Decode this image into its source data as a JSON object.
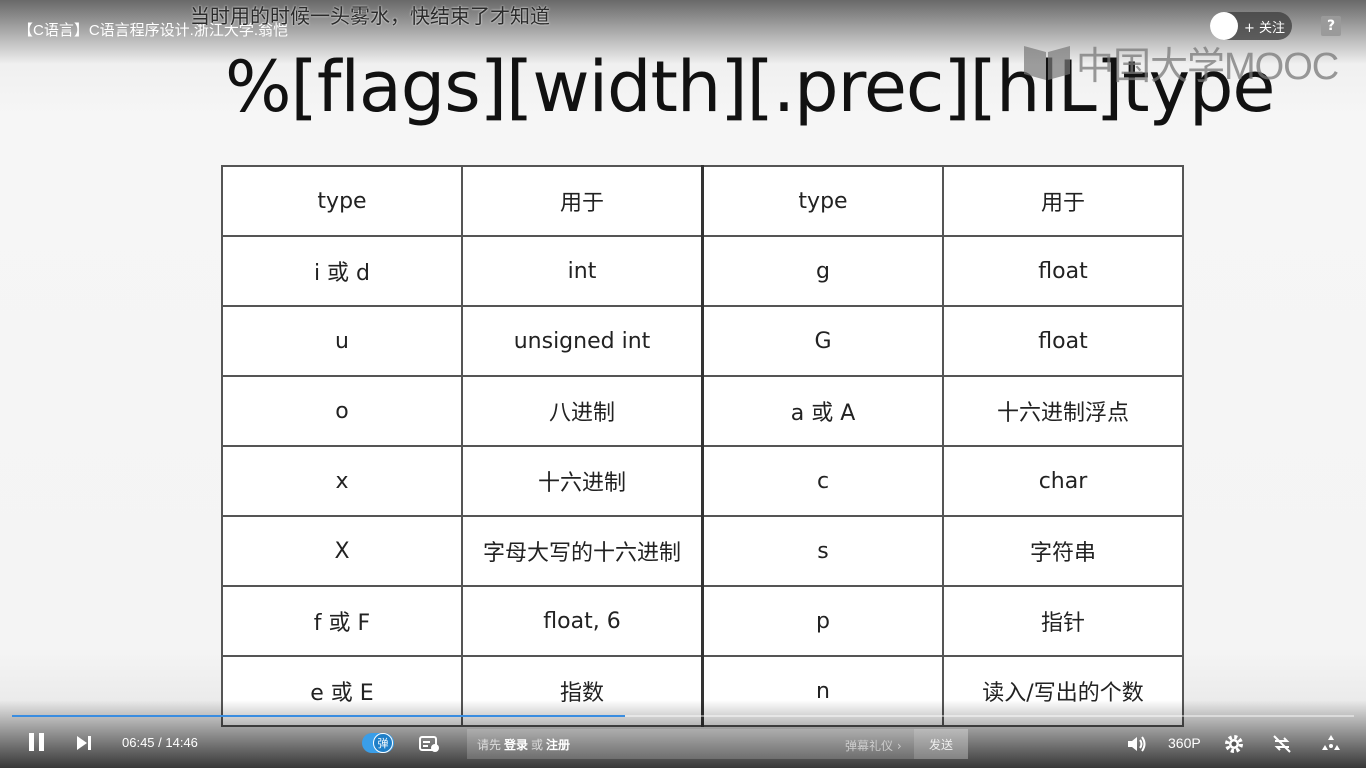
{
  "player": {
    "course_title": "【C语言】C语言程序设计.浙江大学.翁恺",
    "danmaku": "当时用的时候一头雾水，快结束了才知道",
    "follow_label": "+ 关注",
    "help_label": "?",
    "logo_text": "中国大学MOOC",
    "current_time": "06:45",
    "duration": "14:46",
    "time_display": "06:45 / 14:46",
    "progress": 0.457,
    "danmaku_toggle_label": "弹",
    "comment": {
      "prefix": "请先",
      "login": "登录",
      "or": "或",
      "register": "注册"
    },
    "gift_label": "弹幕礼仪 ›",
    "send_label": "发送",
    "quality_label": "360P"
  },
  "slide": {
    "heading": "%[flags][width][.prec][hlL]type",
    "table": {
      "rows": [
        [
          "type",
          "用于",
          "type",
          "用于"
        ],
        [
          "i 或 d",
          "int",
          "g",
          "float"
        ],
        [
          "u",
          "unsigned int",
          "G",
          "float"
        ],
        [
          "o",
          "八进制",
          "a 或 A",
          "十六进制浮点"
        ],
        [
          "x",
          "十六进制",
          "c",
          "char"
        ],
        [
          "X",
          "字母大写的十六进制",
          "s",
          "字符串"
        ],
        [
          "f 或 F",
          "float, 6",
          "p",
          "指针"
        ],
        [
          "e 或 E",
          "指数",
          "n",
          "读入/写出的个数"
        ]
      ]
    }
  },
  "colors": {
    "accent": "#3a8de0",
    "progress": "#3a8de0"
  }
}
